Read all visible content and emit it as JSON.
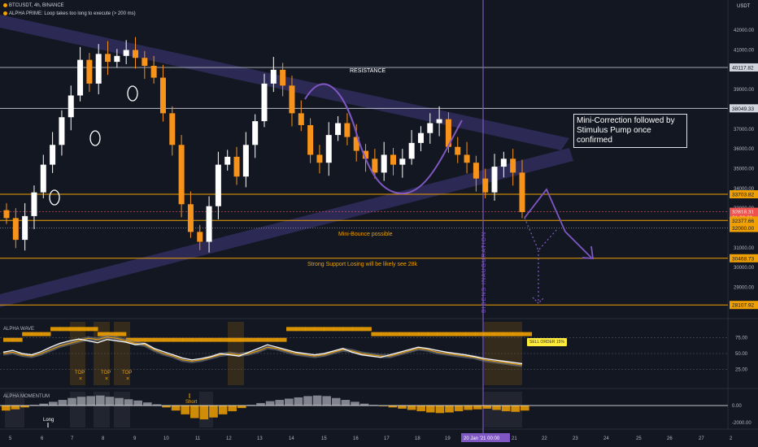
{
  "header": {
    "symbol_line": "BTCUSDT, 4h, BINANCE",
    "indicator_line": "ALPHA PRIME: Loop takes too long to execute (> 200 ms)",
    "currency": "USDT"
  },
  "colors": {
    "background": "#131722",
    "up": "#ffffff",
    "down": "#f7931a",
    "channel": "#5c4bb3",
    "accent": "#7e57c2",
    "orange": "#f0a000"
  },
  "panels": {
    "wave_title": "ALPHA WAVE",
    "momentum_title": "ALPHA MOMENTUM"
  },
  "annotations": {
    "resistance": "RESISTANCE",
    "mini_bounce": "Mini-Bounce possible",
    "support": "Strong Support Losing will be likely see 28k",
    "note": "Mini-Correction followed by Stimulus Pump once confirmed",
    "vertical_text": "BIDENS INAUGURATION",
    "sell_label": "SELL ORDER 15%",
    "top_labels": [
      "TOP",
      "TOP",
      "TOP"
    ],
    "long_label": "Long",
    "short_label": "Short"
  },
  "chart_data": {
    "type": "candlestick",
    "ylim": [
      27500,
      42500
    ],
    "y_ticks": [
      29000,
      30000,
      31000,
      33000,
      34000,
      35000,
      36000,
      37000,
      39000,
      41000,
      42000
    ],
    "x_ticks": [
      "5",
      "6",
      "7",
      "8",
      "9",
      "10",
      "11",
      "12",
      "13",
      "14",
      "15",
      "16",
      "17",
      "18",
      "19",
      "20 Jan '21",
      "21",
      "22",
      "23",
      "24",
      "25",
      "26",
      "27",
      "2"
    ],
    "crosshair_time": "00:00",
    "price_labels": [
      {
        "text": "40117.82",
        "value": 40117.82,
        "kind": "white"
      },
      {
        "text": "38049.33",
        "value": 38049.33,
        "kind": "white"
      },
      {
        "text": "33703.82",
        "value": 33703.82,
        "kind": "orange"
      },
      {
        "text": "32818.31",
        "value": 32818.31,
        "kind": "red"
      },
      {
        "text": "01:00:29",
        "value": 32530,
        "kind": "red"
      },
      {
        "text": "32377.66",
        "value": 32377.66,
        "kind": "orange"
      },
      {
        "text": "32000.00",
        "value": 32000,
        "kind": "orange"
      },
      {
        "text": "30468.73",
        "value": 30468.73,
        "kind": "orange"
      },
      {
        "text": "28107.92",
        "value": 28107.92,
        "kind": "orange"
      }
    ],
    "closes": [
      32500,
      31400,
      32600,
      33800,
      35200,
      36200,
      37600,
      38700,
      40500,
      39300,
      40800,
      40400,
      40700,
      41000,
      40600,
      40200,
      39600,
      37800,
      36200,
      33200,
      31800,
      31300,
      33100,
      35200,
      35600,
      34600,
      36200,
      37400,
      39300,
      40000,
      39200,
      37800,
      37200,
      35700,
      35300,
      36700,
      37300,
      36600,
      35900,
      35500,
      34800,
      35700,
      35200,
      35500,
      36300,
      36800,
      37300,
      37500,
      36100,
      35700,
      35300,
      34500,
      33800,
      35100,
      35500,
      34800,
      32800
    ],
    "wave": {
      "y_ticks": [
        25,
        50,
        75
      ],
      "line": [
        52,
        55,
        50,
        48,
        53,
        60,
        66,
        70,
        73,
        70,
        67,
        72,
        70,
        68,
        64,
        66,
        58,
        53,
        48,
        43,
        40,
        42,
        45,
        50,
        48,
        46,
        52,
        58,
        64,
        60,
        56,
        52,
        50,
        48,
        50,
        54,
        58,
        52,
        48,
        46,
        44,
        48,
        52,
        56,
        60,
        58,
        55,
        52,
        50,
        48,
        45,
        42,
        40,
        38,
        36,
        34
      ],
      "shadow": [
        50,
        52,
        48,
        46,
        50,
        56,
        62,
        66,
        70,
        74,
        72,
        76,
        74,
        70,
        66,
        64,
        56,
        50,
        46,
        40,
        38,
        40,
        44,
        48,
        50,
        48,
        50,
        54,
        60,
        58,
        54,
        50,
        48,
        46,
        48,
        52,
        56,
        54,
        50,
        48,
        46,
        46,
        50,
        54,
        58,
        56,
        52,
        50,
        48,
        46,
        44,
        40,
        38,
        36,
        34,
        32
      ],
      "bars": [
        71,
        71,
        80,
        80,
        80,
        88,
        88,
        88,
        88,
        88,
        80,
        80,
        80,
        71,
        71,
        71,
        71,
        71,
        71,
        71,
        71,
        71,
        71,
        71,
        71,
        71,
        71,
        71,
        71,
        71,
        88,
        88,
        88,
        88,
        88,
        88,
        88,
        88,
        88,
        80,
        80,
        80,
        80,
        80,
        80,
        80,
        80,
        80,
        80,
        80,
        80,
        80,
        80,
        80,
        80,
        80
      ]
    },
    "momentum": {
      "y_ticks": [
        0,
        -2000
      ],
      "values": [
        -800,
        -600,
        -300,
        100,
        300,
        600,
        900,
        1200,
        1400,
        1500,
        1600,
        1400,
        1200,
        1000,
        800,
        500,
        200,
        -300,
        -800,
        -1400,
        -2000,
        -2200,
        -1900,
        -1400,
        -900,
        -400,
        100,
        400,
        700,
        900,
        1100,
        1300,
        1500,
        1600,
        1500,
        1200,
        900,
        600,
        300,
        100,
        -100,
        -300,
        -500,
        -700,
        -900,
        -1100,
        -1200,
        -1100,
        -900,
        -700,
        -600,
        -500,
        -700,
        -900,
        -1000,
        -800
      ]
    }
  }
}
